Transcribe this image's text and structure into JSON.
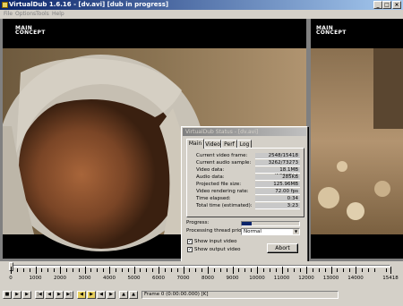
{
  "app": {
    "title": "VirtualDub 1.6.16 - [dv.avi] [dub in progress]",
    "menu": [
      "File",
      "Options",
      "Tools",
      "Help"
    ]
  },
  "panes": {
    "input_logo": [
      "MAIN",
      "CONCEPT"
    ],
    "output_logo": [
      "MAIN",
      "CONCEPT"
    ]
  },
  "status_dialog": {
    "title": "VirtualDub Status - [dv.avi]",
    "tabs": [
      "Main",
      "Video",
      "Perf",
      "Log"
    ],
    "stats": [
      {
        "label": "Current video frame:",
        "value": "2548/15418"
      },
      {
        "label": "Current audio sample:",
        "value": "3262/73273"
      },
      {
        "label": "Video data:",
        "value": "18.1MB (182KB/s)"
      },
      {
        "label": "Audio data:",
        "value": "285KB"
      },
      {
        "label": "Projected file size:",
        "value": "125.96MB"
      },
      {
        "label": "Video rendering rate:",
        "value": "72.00 fps"
      },
      {
        "label": "Time elapsed:",
        "value": "0:34"
      },
      {
        "label": "Total time (estimated):",
        "value": "3:23"
      }
    ],
    "progress_label": "Progress:",
    "progress_fraction": 0.165,
    "priority_label": "Processing thread priority:",
    "priority_value": "Normal",
    "show_input_label": "Show input video",
    "show_output_label": "Show output video",
    "show_input_checked": true,
    "show_output_checked": true,
    "abort_label": "Abort"
  },
  "timeline": {
    "labels": [
      "0",
      "1000",
      "2000",
      "3000",
      "4000",
      "5000",
      "6000",
      "7000",
      "8000",
      "9000",
      "10000",
      "11000",
      "12000",
      "13000",
      "14000",
      "15418"
    ],
    "current_frame": 0,
    "total_frames": 15418
  },
  "toolbar": {
    "frame_text": "Frame 0 (0:00:00.000) [K]"
  },
  "colors": {
    "title_active_start": "#0a246a",
    "title_active_end": "#a6caf0",
    "progress": "#0a246a"
  }
}
